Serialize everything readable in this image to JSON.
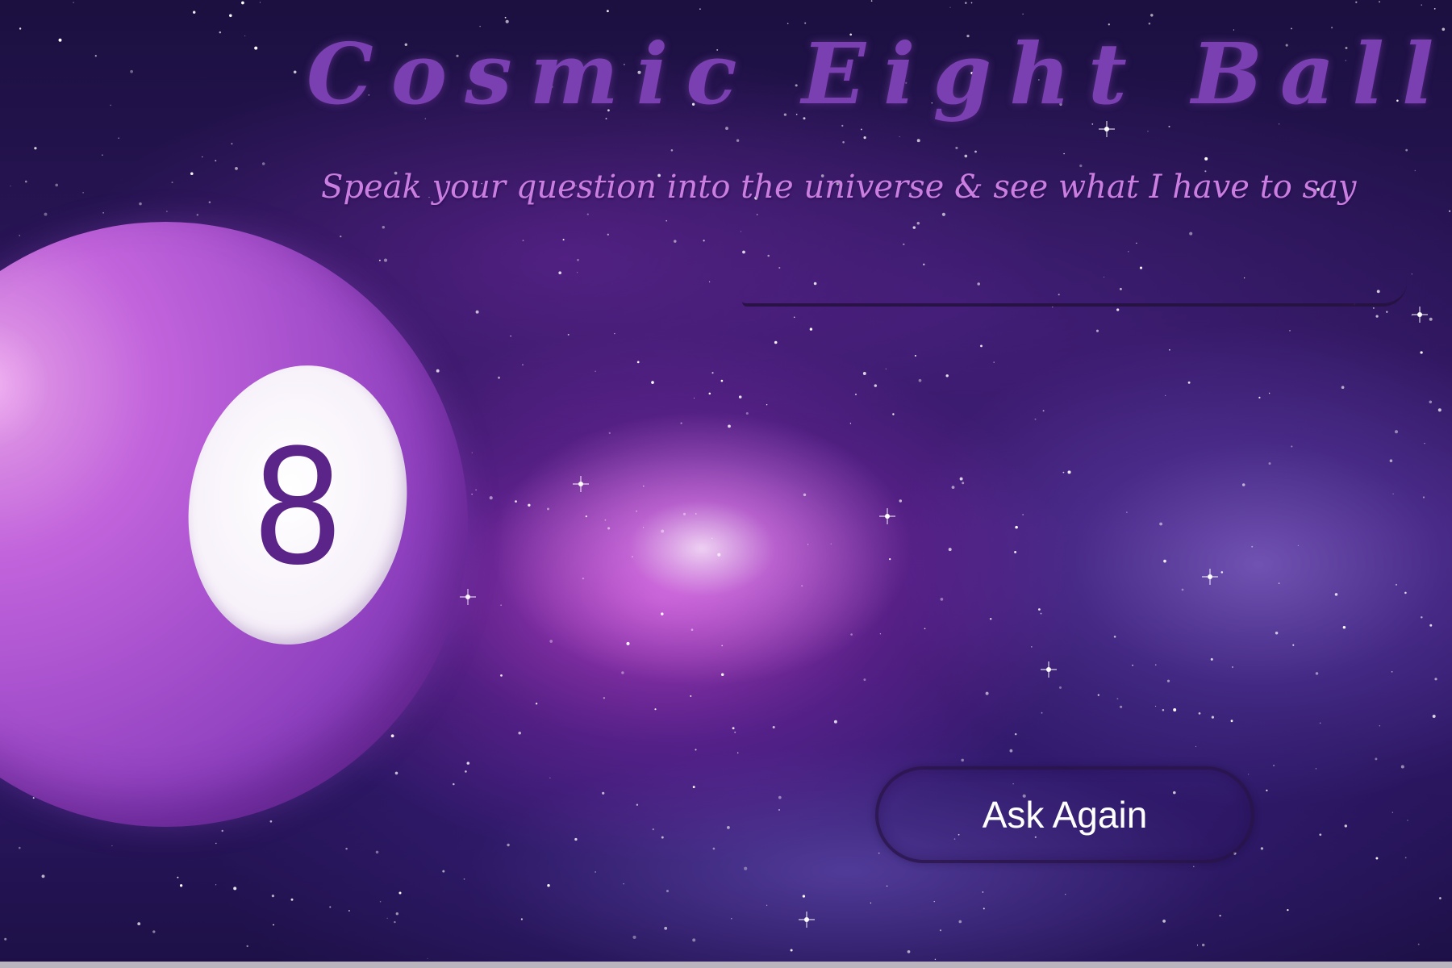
{
  "header": {
    "title": "Cosmic Eight Ball",
    "subtitle": "Speak your question into the universe & see what I have to say"
  },
  "question_input": {
    "value": "",
    "placeholder": ""
  },
  "eight_ball": {
    "number": "8"
  },
  "ask_button": {
    "label": "Ask Again"
  },
  "colors": {
    "title": "#7a3fb0",
    "subtitle": "#c97ee0",
    "ball": "#a851ce",
    "ball_number": "#5a2488",
    "background": "#2a1558"
  }
}
